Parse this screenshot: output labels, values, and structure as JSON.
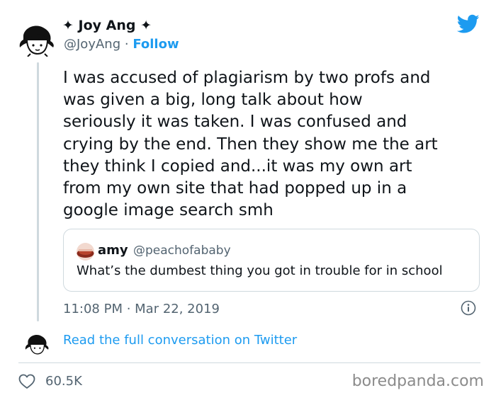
{
  "author": {
    "name": "✦ Joy Ang ✦",
    "handle": "@JoyAng",
    "separator": "·",
    "follow_label": "Follow"
  },
  "icons": {
    "brand": "twitter-bird-icon",
    "brand_color": "#1d9bf0",
    "info": "info-icon",
    "like": "heart-icon"
  },
  "tweet": {
    "lines": [
      "I was accused of plagiarism by two profs and",
      "was given a big, long talk about how",
      "seriously it was taken. I was confused and",
      "crying by the end. Then they show me the art",
      "they think I copied and...it was my own art",
      "from my own site that had popped up in a",
      "google image search smh"
    ],
    "timestamp": "11:08 PM · Mar 22, 2019"
  },
  "quoted": {
    "name": "amy",
    "handle": "@peachofababy",
    "text": "What’s the dumbest thing you got in trouble for in school"
  },
  "conversation_link": "Read the full conversation on Twitter",
  "likes": "60.5K",
  "watermark": "boredpanda.com",
  "colors": {
    "link": "#1d9bf0",
    "muted": "#536471",
    "border": "#cfd9de",
    "text": "#0f1419"
  }
}
